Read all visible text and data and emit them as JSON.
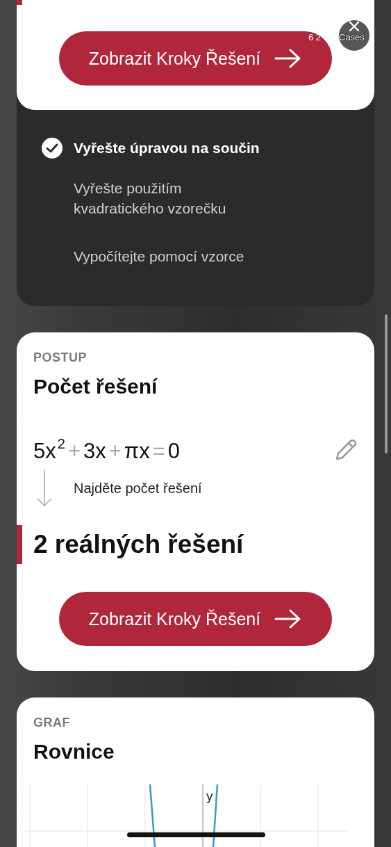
{
  "top_card": {
    "button": "Zobrazit Kroky Řešení"
  },
  "overlay": {
    "count": "6 2",
    "label": "Cases"
  },
  "methods": [
    {
      "label": "Vyřešte úpravou na součin",
      "selected": true
    },
    {
      "label": "Vyřešte použitím kvadratického vzorečku",
      "selected": false
    },
    {
      "label": "Vypočítejte pomocí vzorce",
      "selected": false
    }
  ],
  "steps_card": {
    "section": "POSTUP",
    "title": "Počet řešení",
    "equation": [
      {
        "text": "5x",
        "kind": "term"
      },
      {
        "text": "2",
        "kind": "sup"
      },
      {
        "text": "+",
        "kind": "op"
      },
      {
        "text": "3x",
        "kind": "term"
      },
      {
        "text": "+",
        "kind": "op"
      },
      {
        "text": "πx",
        "kind": "term"
      },
      {
        "text": "=",
        "kind": "op"
      },
      {
        "text": "0",
        "kind": "term"
      }
    ],
    "step": "Najděte počet řešení",
    "result": "2 reálných řešení",
    "button": "Zobrazit Kroky Řešení"
  },
  "graph_card": {
    "section": "GRAF",
    "title": "Rovnice",
    "axis_label": "y"
  }
}
